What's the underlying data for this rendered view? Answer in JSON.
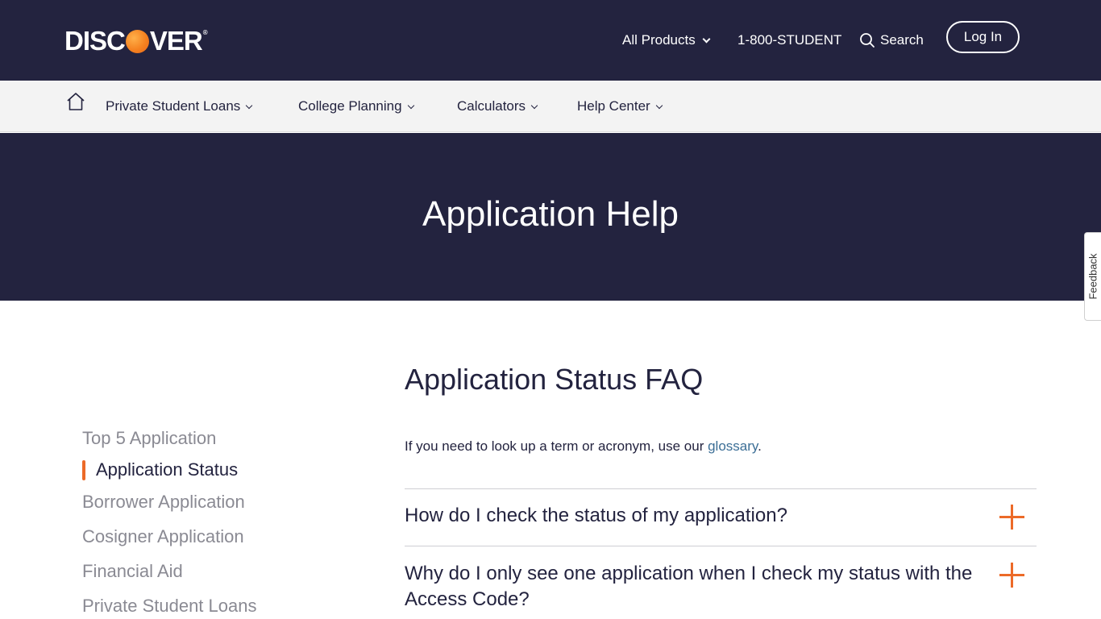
{
  "brand": {
    "logo_text_left": "DISC",
    "logo_text_right": "VER",
    "accent_color": "#ec6a28",
    "navy_color": "#23233f"
  },
  "header": {
    "all_products": "All Products",
    "phone": "1-800-STUDENT",
    "search": "Search",
    "login": "Log In"
  },
  "subnav": {
    "items": [
      {
        "label": "Private Student Loans"
      },
      {
        "label": "College Planning"
      },
      {
        "label": "Calculators"
      },
      {
        "label": "Help Center"
      }
    ]
  },
  "hero": {
    "title": "Application Help"
  },
  "feedback": {
    "label": "Feedback"
  },
  "sidenav": {
    "items": [
      {
        "label": "Top 5 Application"
      },
      {
        "label": "Application Status"
      },
      {
        "label": "Borrower Application"
      },
      {
        "label": "Cosigner Application"
      },
      {
        "label": "Financial Aid"
      },
      {
        "label": "Private Student Loans"
      }
    ],
    "active_index": 1
  },
  "main": {
    "title": "Application Status FAQ",
    "intro_prefix": "If you need to look up a term or acronym, use our ",
    "intro_link": "glossary",
    "intro_suffix": ".",
    "questions": [
      {
        "text": "How do I check the status of my application?"
      },
      {
        "text": "Why do I only see one application when I check my status with the Access Code?"
      }
    ]
  }
}
